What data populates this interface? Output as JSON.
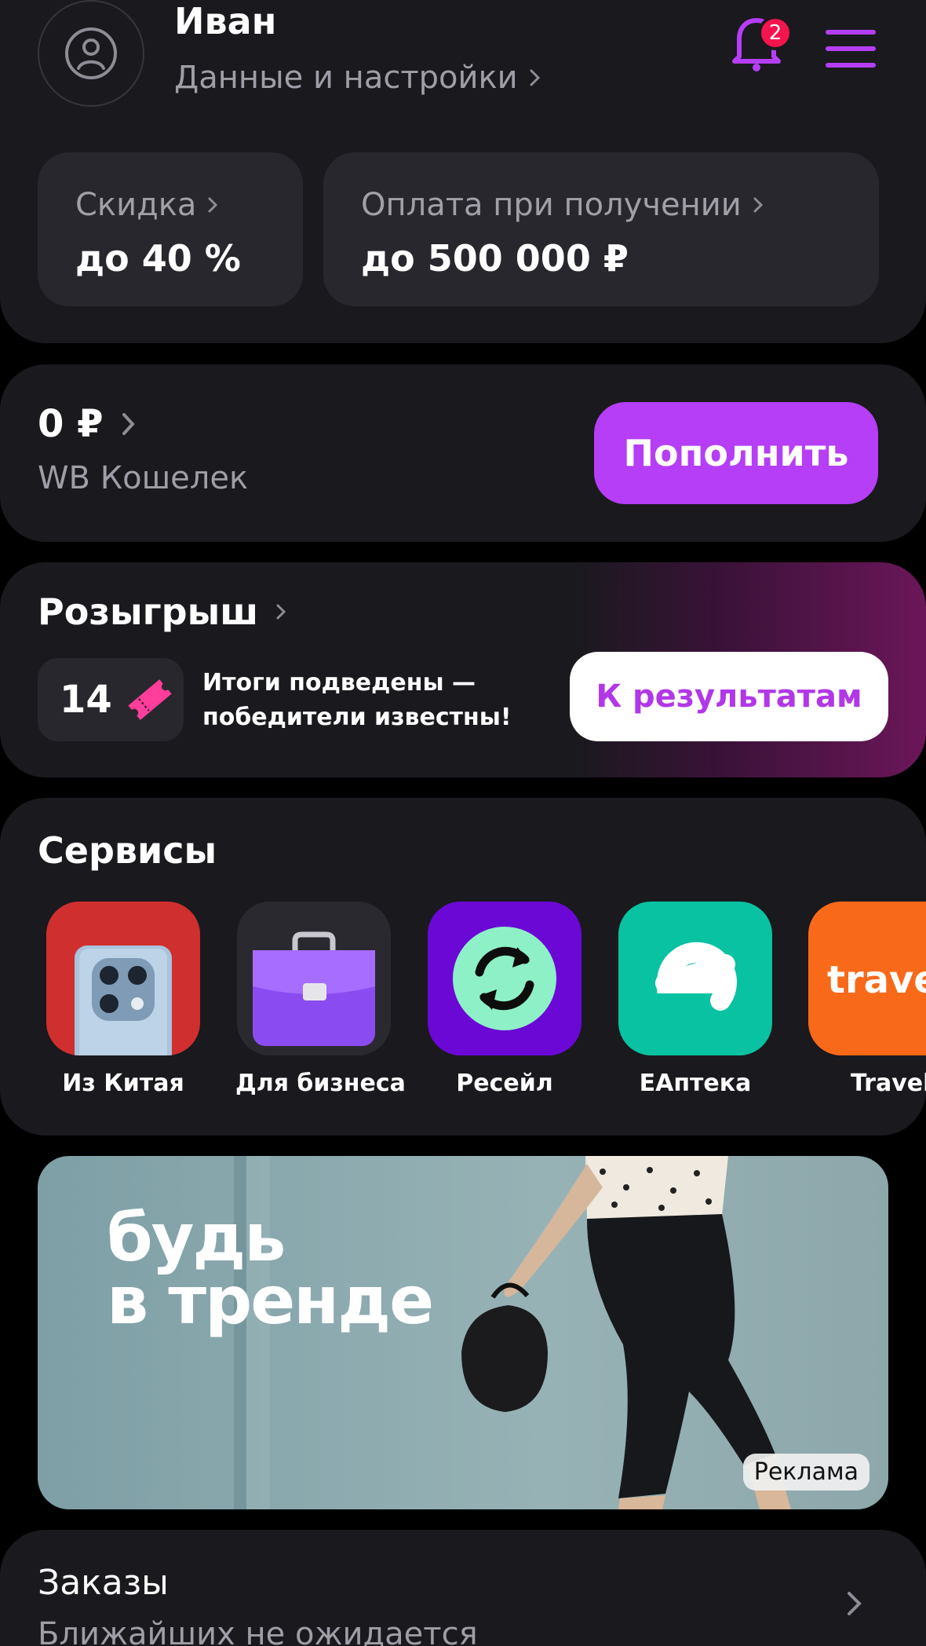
{
  "profile": {
    "name": "Иван",
    "subtitle": "Данные и настройки",
    "notifications_count": "2"
  },
  "promos": [
    {
      "label": "Скидка",
      "value": "до 40 %"
    },
    {
      "label": "Оплата при получении",
      "value": "до 500 000 ₽"
    }
  ],
  "wallet": {
    "amount": "0 ₽",
    "label": "WB Кошелек",
    "topup_label": "Пополнить"
  },
  "raffle": {
    "title": "Розыгрыш",
    "tickets": "14",
    "text": "Итоги подведены — победители известны!",
    "button_label": "К результатам"
  },
  "services": {
    "title": "Сервисы",
    "items": [
      {
        "label": "Из Китая",
        "icon": "phone-icon",
        "color": "#d02f2f"
      },
      {
        "label": "Для бизнеса",
        "icon": "briefcase-icon",
        "color": "#2a2930"
      },
      {
        "label": "Ресейл",
        "icon": "exchange-icon",
        "color": "#6b08d6"
      },
      {
        "label": "ЕАптека",
        "icon": "e-logo-icon",
        "color": "#08c2a2"
      },
      {
        "label": "Travel",
        "tile_text": "travel",
        "icon": "travel-logo-icon",
        "color": "#f86a1a"
      }
    ]
  },
  "ad": {
    "headline_line1": "будь",
    "headline_line2": "в тренде",
    "tag": "Реклама"
  },
  "orders": {
    "title": "Заказы",
    "subtitle": "Ближайших не ожидается"
  },
  "colors": {
    "accent": "#b53ef6",
    "card_bg": "#1a191e",
    "badge": "#f4144e"
  }
}
